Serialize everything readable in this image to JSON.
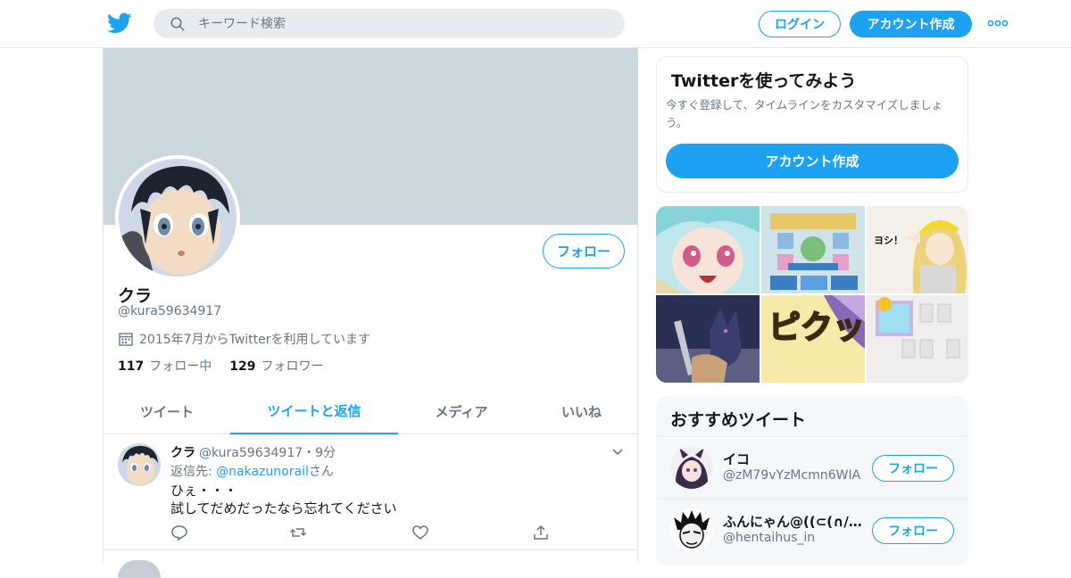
{
  "header": {
    "logo_icon": "twitter-bird-icon",
    "search_placeholder": "キーワード検索",
    "login_label": "ログイン",
    "signup_label": "アカウント作成",
    "more_icon": "more-dots-icon",
    "brand_color": "#1da1f2"
  },
  "profile": {
    "name": "クラ",
    "handle": "@kura59634917",
    "joined": "2015年7月からTwitterを利用しています",
    "following_count": "117",
    "following_label": "フォロー中",
    "followers_count": "129",
    "followers_label": "フォロワー",
    "follow_button": "フォロー"
  },
  "tabs": [
    {
      "label": "ツイート",
      "active": false
    },
    {
      "label": "ツイートと返信",
      "active": true
    },
    {
      "label": "メディア",
      "active": false
    },
    {
      "label": "いいね",
      "active": false
    }
  ],
  "tweet": {
    "name": "クラ",
    "handle": "@kura59634917",
    "separator": "・",
    "time": "9分",
    "reply_prefix": "返信先: ",
    "reply_to": "@nakazunorail",
    "reply_suffix": "さん",
    "line1": "ひぇ・・・",
    "line2": "試してだめだったなら忘れてください",
    "actions": [
      "reply-icon",
      "retweet-icon",
      "like-icon",
      "share-icon"
    ]
  },
  "signup_card": {
    "title": "Twitterを使ってみよう",
    "description": "今すぐ登録して、タイムラインをカスタマイズしましょう。",
    "button": "アカウント作成"
  },
  "media_labels": {
    "yoshi": "ヨシ！",
    "piku": "ピクッ"
  },
  "recommended": {
    "title": "おすすめツイート",
    "items": [
      {
        "name": "イコ",
        "handle": "@zM79vYzMcmn6WIA",
        "follow": "フォロー"
      },
      {
        "name": "ふんにゃん@((⊂(∩///゛...",
        "handle": "@hentaihus_in",
        "follow": "フォロー"
      }
    ]
  }
}
